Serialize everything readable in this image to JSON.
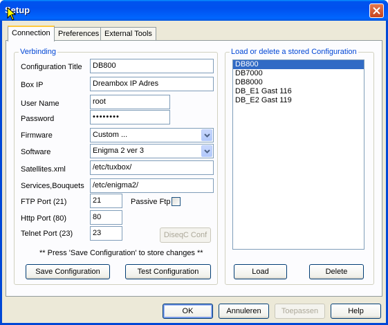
{
  "window": {
    "title": "Setup"
  },
  "tabs": [
    {
      "label": "Connection",
      "active": true
    },
    {
      "label": "Preferences",
      "active": false
    },
    {
      "label": "External Tools",
      "active": false
    }
  ],
  "connection": {
    "group_title": "Verbinding",
    "fields": {
      "config_title": {
        "label": "Configuration Title",
        "value": "DB800"
      },
      "box_ip": {
        "label": "Box IP",
        "value": "Dreambox IP Adres"
      },
      "user_name": {
        "label": "User Name",
        "value": "root"
      },
      "password": {
        "label": "Password",
        "value": "••••••••"
      },
      "firmware": {
        "label": "Firmware",
        "value": "Custom ..."
      },
      "software": {
        "label": "Software",
        "value": "Enigma 2 ver 3"
      },
      "satellites": {
        "label": "Satellites.xml",
        "value": "/etc/tuxbox/"
      },
      "services": {
        "label": "Services,Bouquets",
        "value": "/etc/enigma2/"
      },
      "ftp_port": {
        "label": "FTP Port (21)",
        "value": "21"
      },
      "http_port": {
        "label": "Http Port (80)",
        "value": "80"
      },
      "telnet_port": {
        "label": "Telnet Port (23)",
        "value": "23"
      }
    },
    "passive_ftp_label": "Passive Ftp",
    "passive_ftp_checked": false,
    "diseqc_label": "DiseqC Conf",
    "note": "** Press 'Save Configuration' to store changes **",
    "save_label": "Save Configuration",
    "test_label": "Test Configuration"
  },
  "stored": {
    "group_title": "Load or delete a stored Configuration",
    "items": [
      "DB800",
      "DB7000",
      "DB8000",
      "DB_E1 Gast 116",
      "DB_E2 Gast 119"
    ],
    "selected_index": 0,
    "load_label": "Load",
    "delete_label": "Delete"
  },
  "footer": {
    "ok_label": "OK",
    "cancel_label": "Annuleren",
    "apply_label": "Toepassen",
    "help_label": "Help"
  },
  "colors": {
    "titlebar": "#0055ea",
    "group_label": "#0046d5",
    "selection": "#316ac5"
  }
}
